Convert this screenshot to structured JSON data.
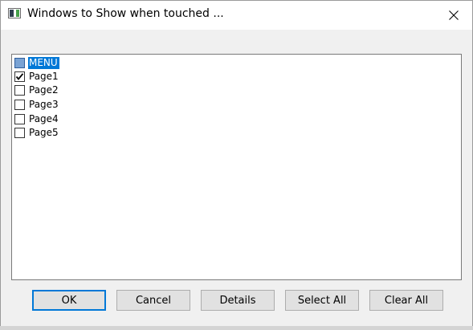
{
  "window": {
    "title": "Windows to Show when touched ..."
  },
  "list": {
    "items": [
      {
        "label": "MENU",
        "checked": false,
        "selected": true
      },
      {
        "label": "Page1",
        "checked": true,
        "selected": false
      },
      {
        "label": "Page2",
        "checked": false,
        "selected": false
      },
      {
        "label": "Page3",
        "checked": false,
        "selected": false
      },
      {
        "label": "Page4",
        "checked": false,
        "selected": false
      },
      {
        "label": "Page5",
        "checked": false,
        "selected": false
      }
    ]
  },
  "buttons": {
    "ok": "OK",
    "cancel": "Cancel",
    "details": "Details",
    "select_all": "Select All",
    "clear_all": "Clear All"
  },
  "colors": {
    "selection": "#0078d7",
    "default_button_border": "#0078d7"
  }
}
